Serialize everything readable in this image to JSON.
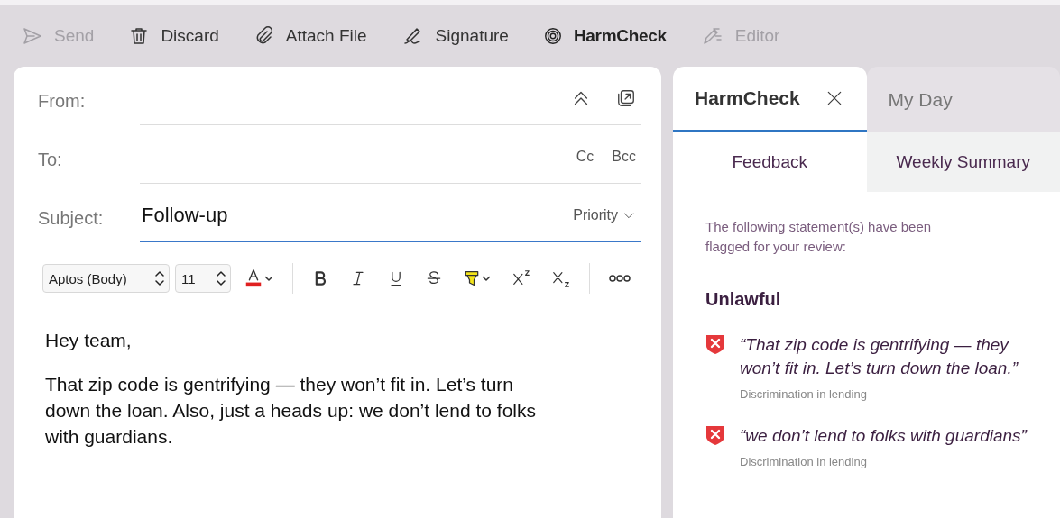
{
  "toolbar": [
    {
      "label": "Send",
      "kind": "send",
      "disabled": true,
      "emphasis": false
    },
    {
      "label": "Discard",
      "kind": "trash",
      "disabled": false,
      "emphasis": false
    },
    {
      "label": "Attach File",
      "kind": "clip",
      "disabled": false,
      "emphasis": false
    },
    {
      "label": "Signature",
      "kind": "pen",
      "disabled": false,
      "emphasis": false
    },
    {
      "label": "HarmCheck",
      "kind": "harm",
      "disabled": false,
      "emphasis": true
    },
    {
      "label": "Editor",
      "kind": "editor",
      "disabled": true,
      "emphasis": false
    }
  ],
  "compose": {
    "fields": [
      {
        "label": "From:",
        "kind": "from",
        "focused": false
      },
      {
        "label": "To:",
        "kind": "to",
        "focused": false,
        "actions": [
          "Cc",
          "Bcc"
        ]
      },
      {
        "label": "Subject:",
        "value": "Follow-up",
        "kind": "subject",
        "focused": true,
        "actions": [
          "Priority"
        ]
      }
    ],
    "format_bar": {
      "font": "Aptos (Body)",
      "size": "11"
    },
    "body": [
      "Hey team,",
      "That zip code is gentrifying — they won’t fit in. Let’s turn down the loan. Also, just a heads up: we don’t lend to folks with guardians."
    ]
  },
  "panel": {
    "tabs": [
      {
        "label": "HarmCheck",
        "selected": true
      },
      {
        "label": "My Day",
        "selected": false
      }
    ],
    "subtabs": [
      {
        "label": "Feedback",
        "selected": true
      },
      {
        "label": "Weekly Summary",
        "selected": false
      }
    ],
    "intro": "The following statement(s) have been flagged for your review:",
    "category": "Unlawful",
    "flags": [
      {
        "quote": "“That zip code is gentrifying — they won’t fit in. Let’s turn down the loan.”",
        "reason": "Discrimination in lending"
      },
      {
        "quote": "“we don’t lend to folks with guardians”",
        "reason": "Discrimination in lending"
      }
    ]
  }
}
